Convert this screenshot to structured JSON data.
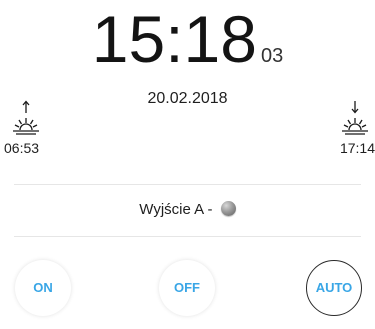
{
  "clock": {
    "hours_minutes": "15:18",
    "seconds": "03"
  },
  "date": "20.02.2018",
  "sunrise": {
    "time": "06:53",
    "icon": "sunrise-icon"
  },
  "sunset": {
    "time": "17:14",
    "icon": "sunset-icon"
  },
  "output": {
    "label": "Wyjście A -",
    "led_state": "off",
    "led_color": "#8c8c8c"
  },
  "buttons": {
    "on_label": "ON",
    "off_label": "OFF",
    "auto_label": "AUTO",
    "selected": "AUTO",
    "accent_color": "#39a6e6"
  }
}
